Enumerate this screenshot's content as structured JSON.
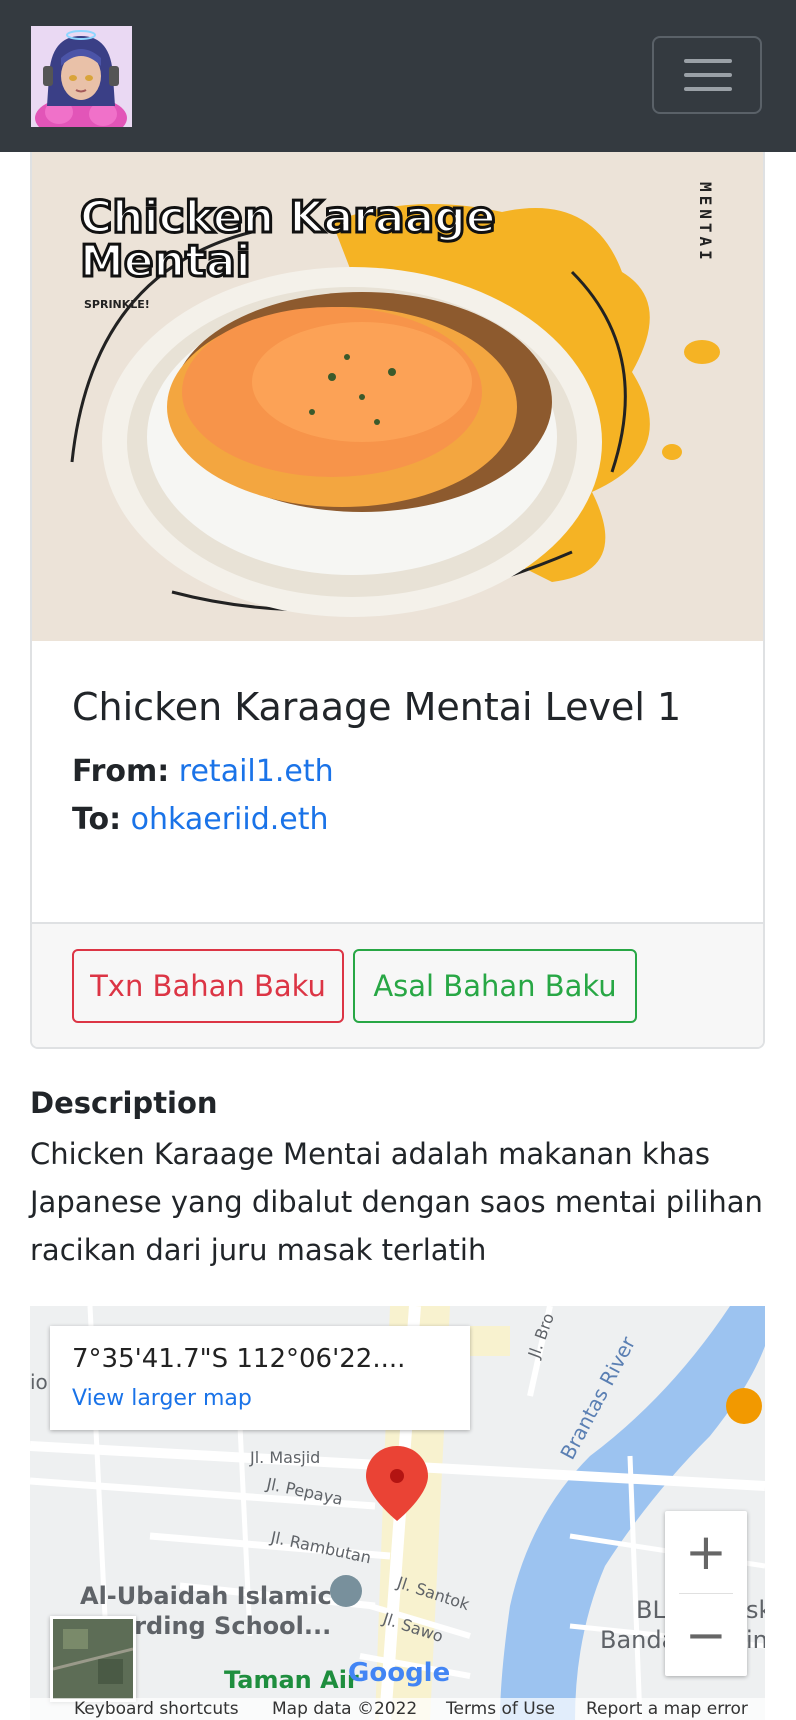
{
  "navbar": {
    "avatar_alt": "avatar",
    "toggler_icon": "hamburger-menu-icon"
  },
  "product": {
    "image_heading_line1": "Chicken Karaage",
    "image_heading_line2": "Mentai",
    "image_tagline": "SPRINKLE!",
    "image_side_text": "MENTAI",
    "title": "Chicken Karaage Mentai Level 1",
    "from_label": "From:",
    "from_value": "retail1.eth",
    "to_label": "To:",
    "to_value": "ohkaeriid.eth"
  },
  "buttons": {
    "txn_label": "Txn Bahan Baku",
    "asal_label": "Asal Bahan Baku"
  },
  "description": {
    "heading": "Description",
    "text": "Chicken Karaage Mentai adalah makanan khas Japanese yang dibalut dengan saos mentai pilihan racikan dari juru masak terlatih"
  },
  "map": {
    "coordinates": "7°35'41.7\"S 112°06'22....",
    "larger_map_link": "View larger map",
    "zoom_in": "+",
    "zoom_out": "−",
    "labels": {
      "masjid": "Jl. Masjid",
      "pepaya": "Jl. Pepaya",
      "rambutan": "Jl. Rambutan",
      "santok": "Jl. Santok",
      "sawo": "Jl. Sawo",
      "river": "Brantas River",
      "school_line1": "Al-Ubaidah Islamic",
      "school_line2": "arding School...",
      "taman": "Taman Air",
      "bl": "BL",
      "banda": "Banda",
      "sk": "sk",
      "in": "in",
      "jl_bro": "Jl. Bro",
      "io": "io"
    },
    "google_logo": "Google",
    "attribution": {
      "shortcuts": "Keyboard shortcuts",
      "map_data": "Map data ©2022",
      "terms": "Terms of Use",
      "report": "Report a map error"
    }
  },
  "colors": {
    "navbar": "#343a40",
    "danger": "#dc3545",
    "success": "#28a745",
    "link": "#1a73e8"
  }
}
